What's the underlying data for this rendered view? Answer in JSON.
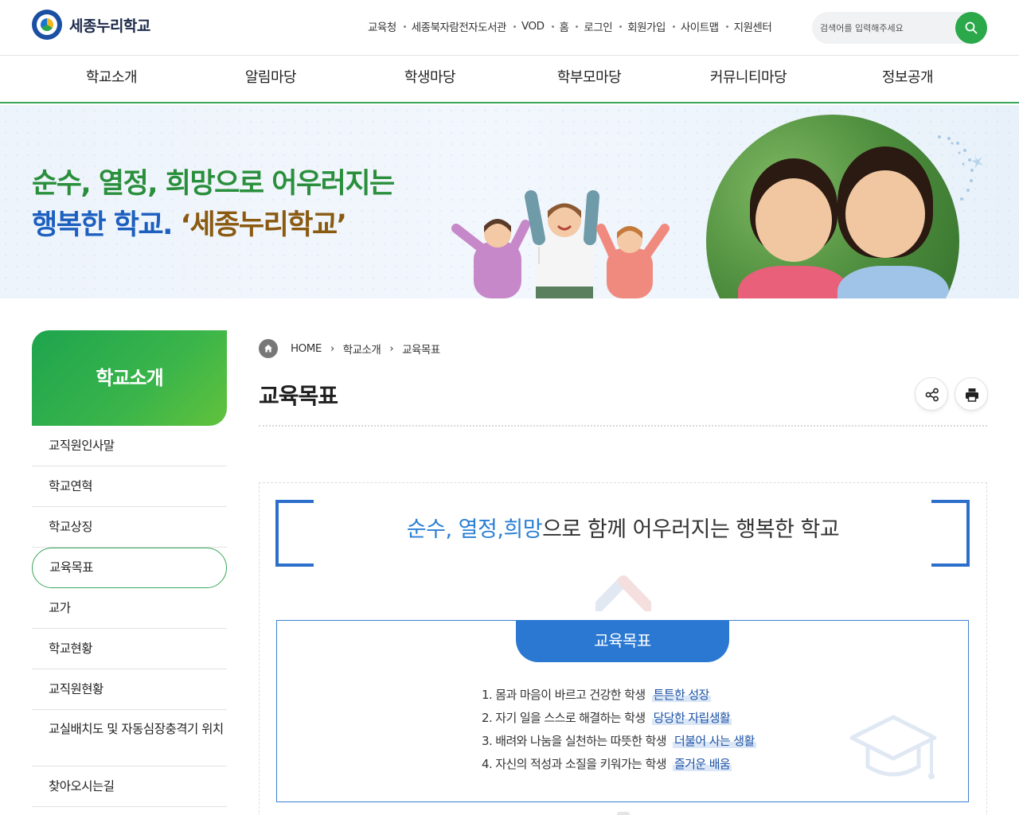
{
  "header": {
    "logo_text": "세종누리학교",
    "util_links": [
      "교육청",
      "세종북자람전자도서관",
      "VOD",
      "홈",
      "로그인",
      "회원가입",
      "사이트맵",
      "지원센터"
    ],
    "search_placeholder": "검색어를 입력해주세요"
  },
  "gnb": [
    "학교소개",
    "알림마당",
    "학생마당",
    "학부모마당",
    "커뮤니티마당",
    "정보공개"
  ],
  "banner": {
    "line1": "순수, 열정, 희망으로 어우러지는",
    "line2_prefix": "행복한 학교.",
    "line2_name": "‘세종누리학교’"
  },
  "lnb": {
    "title": "학교소개",
    "items": [
      "교직원인사말",
      "학교연혁",
      "학교상징",
      "교육목표",
      "교가",
      "학교현황",
      "교직원현황",
      "교실배치도 및 자동심장충격기 위치",
      "찾아오시는길"
    ],
    "active_index": 3
  },
  "breadcrumb": [
    "HOME",
    "학교소개",
    "교육목표"
  ],
  "page_title": "교육목표",
  "vision": {
    "hl1": "순수, 열정,",
    "hl2": "희망",
    "rest": "으로 함께 어우러지는 행복한 학교"
  },
  "goals": {
    "tab_label": "교육목표",
    "items": [
      {
        "text": "1. 몸과 마음이 바르고 건강한 학생",
        "keyword": "튼튼한 성장"
      },
      {
        "text": "2. 자기 일을 스스로 해결하는 학생",
        "keyword": "당당한 자립생활"
      },
      {
        "text": "3. 배려와 나눔을 실천하는 따뜻한 학생",
        "keyword": "더불어 사는 생활"
      },
      {
        "text": "4. 자신의 적성과 소질을 키워가는 학생",
        "keyword": "즐거운 배움"
      }
    ]
  },
  "colors": {
    "brand_green": "#3aa657",
    "brand_blue": "#2b78d2"
  },
  "icons": {
    "search": "search-icon",
    "home": "home-icon",
    "share": "share-icon",
    "print": "print-icon"
  }
}
